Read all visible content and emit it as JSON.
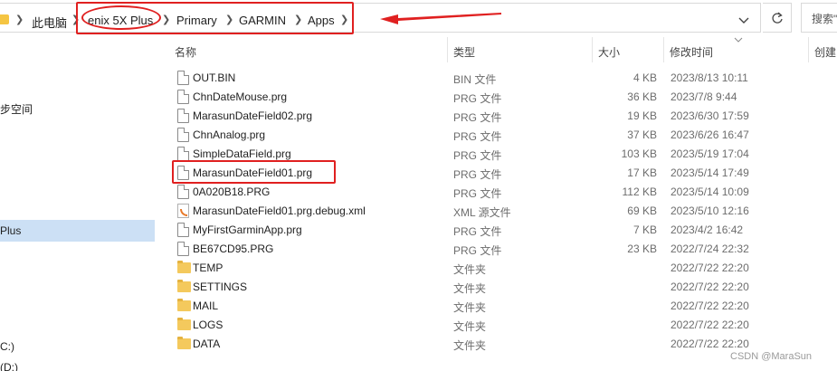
{
  "address_bar": {
    "crumbs": [
      "此电脑",
      "enix 5X Plus",
      "Primary",
      "GARMIN",
      "Apps"
    ],
    "search_placeholder": "搜索\""
  },
  "sidebar": {
    "items": [
      "步空间",
      "Plus",
      "C:)",
      "(D:)"
    ],
    "selected": "Plus"
  },
  "columns": {
    "name": "名称",
    "type": "类型",
    "size": "大小",
    "modified": "修改时间",
    "created": "创建"
  },
  "files": [
    {
      "name": "OUT.BIN",
      "type": "BIN 文件",
      "size": "4 KB",
      "modified": "2023/8/13 10:11",
      "icon": "file-icon"
    },
    {
      "name": "ChnDateMouse.prg",
      "type": "PRG 文件",
      "size": "36 KB",
      "modified": "2023/7/8 9:44",
      "icon": "file-icon"
    },
    {
      "name": "MarasunDateField02.prg",
      "type": "PRG 文件",
      "size": "19 KB",
      "modified": "2023/6/30 17:59",
      "icon": "file-icon"
    },
    {
      "name": "ChnAnalog.prg",
      "type": "PRG 文件",
      "size": "37 KB",
      "modified": "2023/6/26 16:47",
      "icon": "file-icon"
    },
    {
      "name": "SimpleDataField.prg",
      "type": "PRG 文件",
      "size": "103 KB",
      "modified": "2023/5/19 17:04",
      "icon": "file-icon"
    },
    {
      "name": "MarasunDateField01.prg",
      "type": "PRG 文件",
      "size": "17 KB",
      "modified": "2023/5/14 17:49",
      "icon": "file-icon"
    },
    {
      "name": "0A020B18.PRG",
      "type": "PRG 文件",
      "size": "112 KB",
      "modified": "2023/5/14 10:09",
      "icon": "file-icon"
    },
    {
      "name": "MarasunDateField01.prg.debug.xml",
      "type": "XML 源文件",
      "size": "69 KB",
      "modified": "2023/5/10 12:16",
      "icon": "xml-icon"
    },
    {
      "name": "MyFirstGarminApp.prg",
      "type": "PRG 文件",
      "size": "7 KB",
      "modified": "2023/4/2 16:42",
      "icon": "file-icon"
    },
    {
      "name": "BE67CD95.PRG",
      "type": "PRG 文件",
      "size": "23 KB",
      "modified": "2022/7/24 22:32",
      "icon": "file-icon"
    },
    {
      "name": "TEMP",
      "type": "文件夹",
      "size": "",
      "modified": "2022/7/22 22:20",
      "icon": "folder-icon"
    },
    {
      "name": "SETTINGS",
      "type": "文件夹",
      "size": "",
      "modified": "2022/7/22 22:20",
      "icon": "folder-icon"
    },
    {
      "name": "MAIL",
      "type": "文件夹",
      "size": "",
      "modified": "2022/7/22 22:20",
      "icon": "folder-icon"
    },
    {
      "name": "LOGS",
      "type": "文件夹",
      "size": "",
      "modified": "2022/7/22 22:20",
      "icon": "folder-icon"
    },
    {
      "name": "DATA",
      "type": "文件夹",
      "size": "",
      "modified": "2022/7/22 22:20",
      "icon": "folder-icon"
    }
  ],
  "highlighted_file": "MarasunDateField01.prg",
  "annotation_color": "#e02020",
  "watermark": "CSDN @MaraSun"
}
